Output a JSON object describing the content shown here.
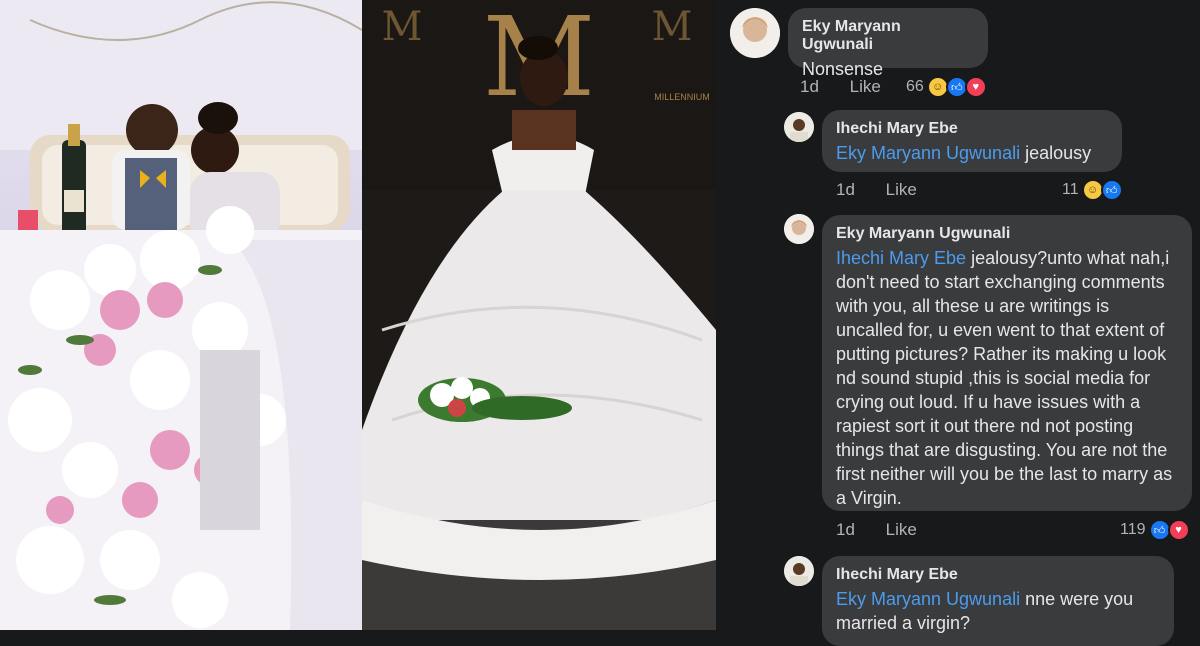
{
  "photos": {
    "left_alt": "couple-kissing-photo",
    "right_alt": "bride-in-gown-photo",
    "backdrop_letter": "M",
    "backdrop_brand": "MILLENNIUM"
  },
  "comments": [
    {
      "author": "Eky Maryann Ugwunali",
      "text": "Nonsense",
      "time": "1d",
      "like_label": "Like",
      "react_count": "66",
      "reactions": [
        "haha-icon",
        "like-icon",
        "love-icon"
      ]
    },
    {
      "author": "Ihechi Mary Ebe",
      "mention": "Eky Maryann Ugwunali",
      "text": " jealousy",
      "time": "1d",
      "like_label": "Like",
      "react_count": "11",
      "reactions": [
        "haha-icon",
        "like-icon"
      ]
    },
    {
      "author": "Eky Maryann Ugwunali",
      "mention": "Ihechi Mary Ebe",
      "text": "  jealousy?unto what nah,i don't need to start exchanging comments with you, all these u are writings is uncalled for, u even went to that extent of putting pictures? Rather its making u look nd sound stupid ,this is social media for crying out loud. If u have issues with a rapiest sort it out there nd not posting things that are disgusting. You are not the first neither will you be the last to marry as a Virgin.",
      "time": "1d",
      "like_label": "Like",
      "react_count": "119",
      "reactions": [
        "like-icon",
        "love-icon"
      ]
    },
    {
      "author": "Ihechi Mary Ebe",
      "mention": "Eky Maryann Ugwunali",
      "text": " nne were you married a virgin?"
    }
  ],
  "colors": {
    "background": "#18191a",
    "bubble": "#3a3b3c",
    "mention": "#4b9cf0",
    "like": "#1877f2",
    "love": "#f33e58",
    "haha": "#f7c843"
  }
}
